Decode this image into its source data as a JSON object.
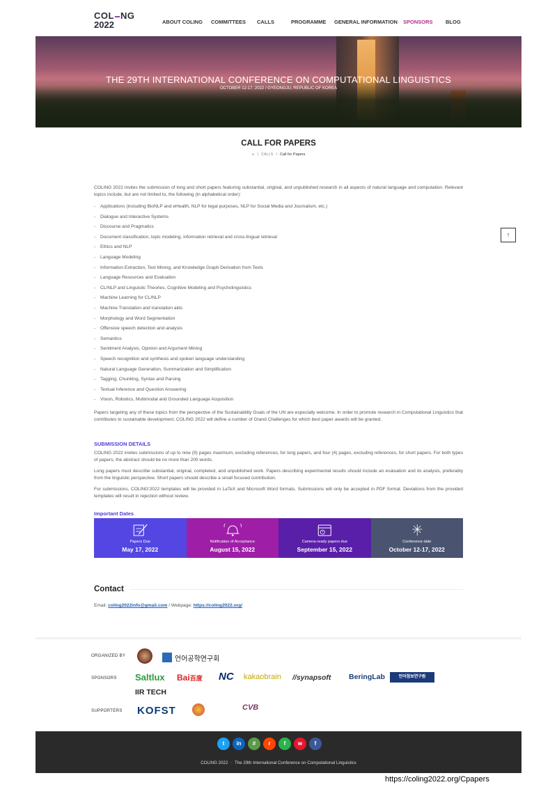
{
  "header": {
    "logo_line1": "COL",
    "logo_line1b": "NG",
    "logo_line2": "2022",
    "nav": [
      "ABOUT COLING",
      "COMMITTEES",
      "CALLS",
      "PROGRAMME",
      "GENERAL INFORMATION",
      "SPONSORS",
      "BLOG"
    ],
    "active_nav": "SPONSORS"
  },
  "hero": {
    "title": "THE 29TH INTERNATIONAL CONFERENCE ON COMPUTATIONAL LINGUISTICS",
    "subtitle": "OCTOBER 12-17, 2022 / GYEONGJU, REPUBLIC OF KOREA"
  },
  "page": {
    "title": "CALL FOR PAPERS",
    "breadcrumb": [
      "CALLS",
      "Call for Papers"
    ]
  },
  "intro": "COLING 2022 invites the submission of long and short papers featuring substantial, original, and unpublished research in all aspects of natural language and computation. Relevant topics include, but are not limited to, the following (in alphabetical order):",
  "topics": [
    "Applications (including BioNLP and eHealth, NLP for legal purposes, NLP for Social Media and Journalism, etc.)",
    "Dialogue and Interactive Systems",
    "Discourse and Pragmatics",
    "Document classification, topic modeling, information retrieval and cross-lingual retrieval",
    "Ethics and NLP",
    "Language Modeling",
    "Information Extraction, Text Mining, and Knowledge Graph Derivation from Texts",
    "Language Resources and Evaluation",
    "CL/NLP and Linguistic Theories, Cognitive Modeling and Psycholinguistics",
    "Machine Learning for CL/NLP",
    "Machine Translation and translation aids",
    "Morphology and Word Segmentation",
    "Offensive speech detection and analysis",
    "Semantics",
    "Sentiment Analysis, Opinion and Argument Mining",
    "Speech recognition and synthesis and spoken language understanding",
    "Natural Language Generation, Summarization and Simplification",
    "Tagging, Chunking, Syntax and Parsing",
    "Textual Inference and Question Answering",
    "Vision, Robotics, Multimodal and Grounded Language Acquisition"
  ],
  "sustainability": "Papers targeting any of these topics from the perspective of the Sustainability Goals of the UN are especially welcome. In order to promote research in Computational Linguistics that contributes to sustainable development, COLING 2022 will define a number of Grand Challenges for which best paper awards will be granted.",
  "submission": {
    "heading": "SUBMISSION DETAILS",
    "p1": "COLING 2022 invites submissions of up to nine (9) pages maximum, excluding references, for long papers, and four (4) pages, excluding references, for short papers. For both types of papers, the abstract should be no more than 200 words.",
    "p2": "Long papers must describe substantial, original, completed, and unpublished work. Papers describing experimental results should include an evaluation and its analysis, preferably from the linguistic perspective. Short papers should describe a small focused contribution.",
    "p3": "For submissions, COLING'2022 templates will be provided in LaTeX and Microsoft Word formats. Submissions will only be accepted in PDF format. Deviations from the provided templates will result in rejection without review."
  },
  "dates": {
    "heading": "Important Dates",
    "items": [
      {
        "label": "Papers Due",
        "value": "May 17, 2022",
        "color": "#5346e2",
        "icon": "paper-pen-icon"
      },
      {
        "label": "Notification of Acceptance",
        "value": "August 15, 2022",
        "color": "#9e1ea8",
        "icon": "bell-icon"
      },
      {
        "label": "Camera-ready papers due",
        "value": "September 15, 2022",
        "color": "#5a1fa8",
        "icon": "calendar-icon"
      },
      {
        "label": "Conference date",
        "value": "October 12-17, 2022",
        "color": "#4a5470",
        "icon": "fireworks-icon"
      }
    ]
  },
  "contact": {
    "heading": "Contact",
    "email_label": "Email:",
    "email": "coling2022info@gmail.com",
    "sep": "/ Webpage:",
    "webpage": "https://coling2022.org/"
  },
  "sponsors": {
    "organized_label": "ORGANIZED BY",
    "organizer_text": "언어공학연구회",
    "sponsors_label": "SPONSORS",
    "sponsor_names": [
      "Saltlux",
      "Bai",
      "百度",
      "NC",
      "kakaobrain",
      "//synapsoft",
      "BeringLab",
      "언어정보연구원",
      "IIR TECH"
    ],
    "supporters_label": "SUPPORTERS",
    "supporter_names": [
      "KOFST",
      "CVB"
    ]
  },
  "footer": {
    "socials": [
      "twitter",
      "linkedin",
      "slack",
      "reddit",
      "feedly",
      "weibo",
      "facebook"
    ],
    "brand": "COLING 2022",
    "tilde": "~",
    "text": "The 29th International Conference on Computational Linguistics"
  },
  "page_url": "https://coling2022.org/Cpapers"
}
